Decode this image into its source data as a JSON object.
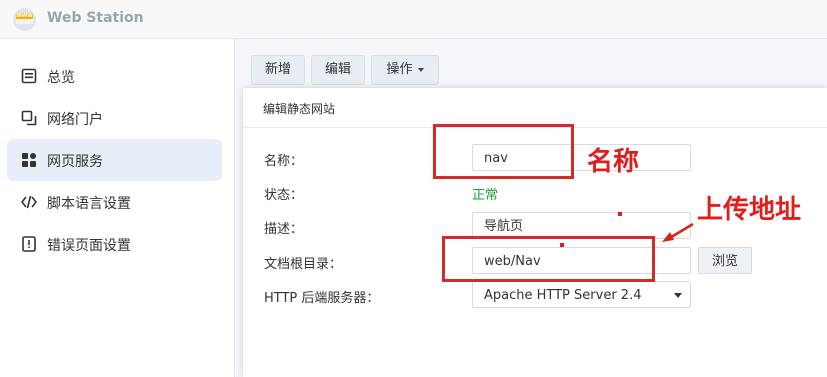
{
  "app": {
    "title": "Web Station"
  },
  "sidebar": {
    "items": [
      {
        "label": "总览",
        "icon": "overview-icon",
        "active": false
      },
      {
        "label": "网络门户",
        "icon": "portal-icon",
        "active": false
      },
      {
        "label": "网页服务",
        "icon": "grid-icon",
        "active": true
      },
      {
        "label": "脚本语言设置",
        "icon": "code-icon",
        "active": false
      },
      {
        "label": "错误页面设置",
        "icon": "error-icon",
        "active": false
      }
    ]
  },
  "toolbar": {
    "add_label": "新增",
    "edit_label": "编辑",
    "action_label": "操作"
  },
  "dialog": {
    "title": "编辑静态网站",
    "fields": {
      "name_label": "名称：",
      "name_value": "nav",
      "status_label": "状态：",
      "status_value": "正常",
      "desc_label": "描述：",
      "desc_value": "导航页",
      "docroot_label": "文档根目录：",
      "docroot_value": "web/Nav",
      "browse_label": "浏览",
      "backend_label": "HTTP 后端服务器：",
      "backend_value": "Apache HTTP Server 2.4"
    }
  },
  "annotations": {
    "name_note": "名称",
    "upload_note": "上传地址"
  },
  "colors": {
    "status_ok": "#12a536",
    "annotation_red": "#e01e1e",
    "active_bg": "#e7eef8"
  }
}
